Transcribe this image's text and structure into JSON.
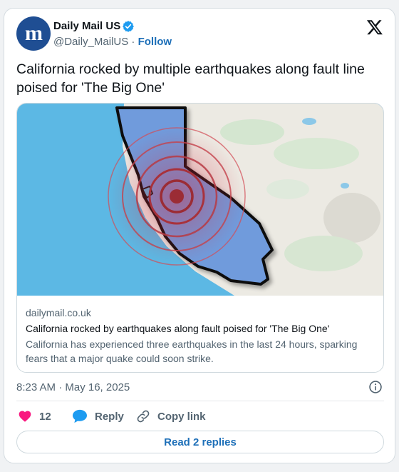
{
  "author": {
    "name": "Daily Mail US",
    "handle": "@Daily_MailUS",
    "separator": "·",
    "follow_label": "Follow",
    "avatar_glyph": "m",
    "avatar_color": "#1f4e93",
    "verified_color": "#1d9bf0"
  },
  "tweet": {
    "text": "California rocked by multiple earthquakes along fault line poised for 'The Big One'"
  },
  "link_card": {
    "image": "california-earthquake-map",
    "domain": "dailymail.co.uk",
    "title": "California rocked by earthquakes along fault poised for 'The Big One'",
    "description": "California has experienced three earthquakes in the last 24 hours, sparking fears that a major quake could soon strike."
  },
  "timestamp": "8:23 AM · May 16, 2025",
  "actions": {
    "likes_count": "12",
    "reply_label": "Reply",
    "copy_link_label": "Copy link"
  },
  "read_replies_label": "Read 2 replies",
  "colors": {
    "accent": "#1d6fb8",
    "like": "#f91880",
    "secondary_text": "#536471",
    "border": "#cfd9de"
  },
  "icons": {
    "brand": "x-logo-icon",
    "verified": "verified-badge-icon",
    "info": "info-icon",
    "like": "heart-icon",
    "reply": "speech-bubble-icon",
    "copy": "link-icon"
  }
}
